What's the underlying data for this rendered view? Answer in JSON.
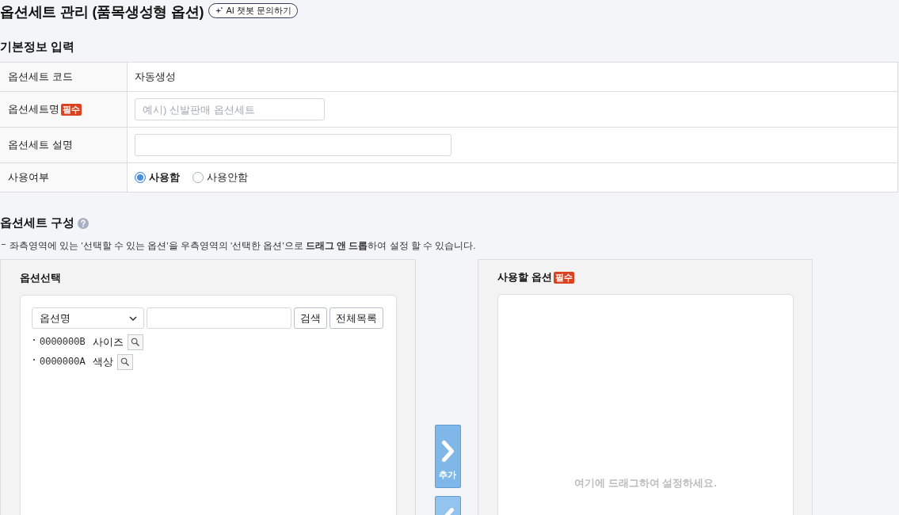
{
  "page": {
    "title": "옵션세트 관리 (품목생성형 옵션)",
    "chatbot_button": "AI 챗봇 문의하기"
  },
  "basic_info": {
    "heading": "기본정보 입력",
    "rows": [
      {
        "kind": "text",
        "label": "옵션세트 코드",
        "value": "자동생성"
      },
      {
        "kind": "input",
        "label": "옵션세트명",
        "badge": "필수",
        "placeholder": "예시) 신발판매 옵션세트"
      },
      {
        "kind": "input",
        "label": "옵션세트 설명"
      },
      {
        "kind": "radio",
        "label": "사용여부",
        "options": [
          {
            "label": "사용함",
            "selected": true
          },
          {
            "label": "사용안함",
            "selected": false
          }
        ]
      }
    ]
  },
  "composition": {
    "heading": "옵션세트 구성",
    "description": "좌측영역에 있는 '선택할 수 있는 옵션'을 우측영역의 '선택한 옵션'으로 **드래그 앤 드롭**하여 설정 할 수 있습니다.",
    "left_panel": {
      "title": "옵션선택",
      "search_by": "옵션명",
      "search_button": "검색",
      "list_all_button": "전체목록",
      "options": [
        {
          "code": "0000000B",
          "name": "사이즈"
        },
        {
          "code": "0000000A",
          "name": "색상"
        }
      ]
    },
    "move_buttons": [
      {
        "kind": "right",
        "label": "추가"
      },
      {
        "kind": "left"
      }
    ],
    "right_panel": {
      "title": "사용할 옵션",
      "badge": "필수",
      "empty_text": "여기에 드래그하여 설정하세요."
    }
  }
}
